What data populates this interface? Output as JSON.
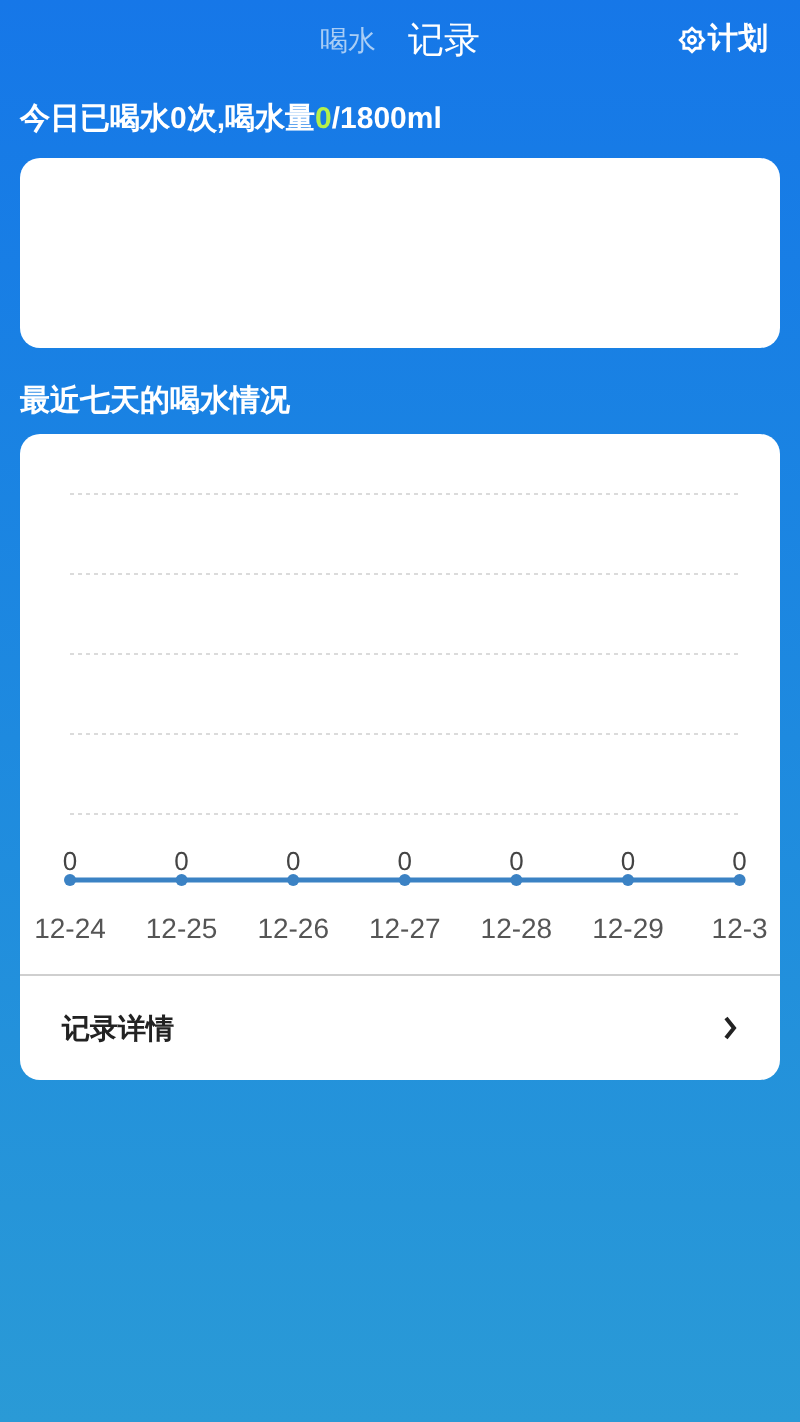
{
  "header": {
    "tabs": [
      {
        "label": "喝水",
        "selected": false
      },
      {
        "label": "记录",
        "selected": true
      }
    ],
    "plan_button": "计划"
  },
  "today_summary": {
    "prefix": "今日已喝水0次,喝水量",
    "amount": "0",
    "suffix": "/1800ml"
  },
  "weekly_section": {
    "title": "最近七天的喝水情况",
    "days": [
      {
        "value": "0",
        "date": "12-24"
      },
      {
        "value": "0",
        "date": "12-25"
      },
      {
        "value": "0",
        "date": "12-26"
      },
      {
        "value": "0",
        "date": "12-27"
      },
      {
        "value": "0",
        "date": "12-28"
      },
      {
        "value": "0",
        "date": "12-29"
      },
      {
        "value": "0",
        "date": "12-3"
      }
    ],
    "details_link": "记录详情"
  }
}
